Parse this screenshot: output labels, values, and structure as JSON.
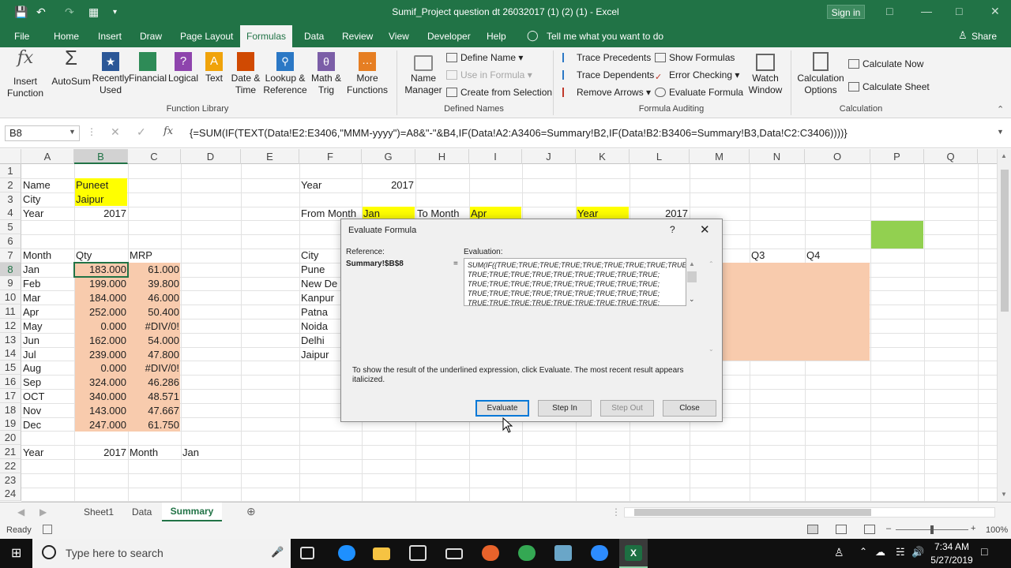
{
  "window": {
    "title": "Sumif_Project question dt 26032017 (1) (2) (1)  -  Excel",
    "signin_label": "Sign in"
  },
  "ribbon_tabs": [
    "File",
    "Home",
    "Insert",
    "Draw",
    "Page Layout",
    "Formulas",
    "Data",
    "Review",
    "View",
    "Developer",
    "Help"
  ],
  "active_tab": "Formulas",
  "tell_me": "Tell me what you want to do",
  "share_label": "Share",
  "ribbon": {
    "function_library": {
      "label": "Function Library",
      "insert_function": "Insert\nFunction",
      "autosum": "AutoSum",
      "recently_used": "Recently\nUsed",
      "financial": "Financial",
      "logical": "Logical",
      "text": "Text",
      "date_time": "Date &\nTime",
      "lookup_reference": "Lookup &\nReference",
      "math_trig": "Math &\nTrig",
      "more_functions": "More\nFunctions"
    },
    "defined_names": {
      "label": "Defined Names",
      "name_manager": "Name\nManager",
      "define_name": "Define Name",
      "use_in_formula": "Use in Formula",
      "create_from_selection": "Create from Selection"
    },
    "formula_auditing": {
      "label": "Formula Auditing",
      "trace_precedents": "Trace Precedents",
      "trace_dependents": "Trace Dependents",
      "remove_arrows": "Remove Arrows",
      "show_formulas": "Show Formulas",
      "error_checking": "Error Checking",
      "evaluate_formula": "Evaluate Formula",
      "watch_window": "Watch\nWindow"
    },
    "calculation": {
      "label": "Calculation",
      "calculation_options": "Calculation\nOptions",
      "calculate_now": "Calculate Now",
      "calculate_sheet": "Calculate Sheet"
    }
  },
  "formula_bar": {
    "name_box": "B8",
    "formula": "{=SUM(IF(TEXT(Data!E2:E3406,\"MMM-yyyy\")=A8&\"-\"&B4,IF(Data!A2:A3406=Summary!B2,IF(Data!B2:B3406=Summary!B3,Data!C2:C3406))))}"
  },
  "columns": [
    "A",
    "B",
    "C",
    "D",
    "E",
    "F",
    "G",
    "H",
    "I",
    "J",
    "K",
    "L",
    "M",
    "N",
    "O",
    "P",
    "Q"
  ],
  "rows": [
    "1",
    "2",
    "3",
    "4",
    "5",
    "6",
    "7",
    "8",
    "9",
    "10",
    "11",
    "12",
    "13",
    "14",
    "15",
    "16",
    "17",
    "18",
    "19",
    "20",
    "21",
    "22",
    "23",
    "24"
  ],
  "cells": {
    "A2": "Name",
    "B2": "Puneet",
    "A3": "City",
    "B3": "Jaipur",
    "A4": "Year",
    "B4": "2017",
    "A7": "Month",
    "B7": "Qty",
    "C7": "MRP",
    "A8": "Jan",
    "B8": "183.000",
    "C8": "61.000",
    "A9": "Feb",
    "B9": "199.000",
    "C9": "39.800",
    "A10": "Mar",
    "B10": "184.000",
    "C10": "46.000",
    "A11": "Apr",
    "B11": "252.000",
    "C11": "50.400",
    "A12": "May",
    "B12": "0.000",
    "C12": "#DIV/0!",
    "A13": "Jun",
    "B13": "162.000",
    "C13": "54.000",
    "A14": "Jul",
    "B14": "239.000",
    "C14": "47.800",
    "A15": "Aug",
    "B15": "0.000",
    "C15": "#DIV/0!",
    "A16": "Sep",
    "B16": "324.000",
    "C16": "46.286",
    "A17": "OCT",
    "B17": "340.000",
    "C17": "48.571",
    "A18": "Nov",
    "B18": "143.000",
    "C18": "47.667",
    "A19": "Dec",
    "B19": "247.000",
    "C19": "61.750",
    "A21": "Year",
    "B21": "2017",
    "C21": "Month",
    "D21": "Jan",
    "F2": "Year",
    "G2": "2017",
    "F4": "From Month",
    "G4": "Jan",
    "H4": "To Month",
    "I4": "Apr",
    "K4": "Year",
    "L4": "2017",
    "F7": "City",
    "N7": "Q3",
    "O7": "Q4",
    "F8": "Pune",
    "F9": "New De",
    "F10": "Kanpur",
    "F11": "Patna",
    "F12": "Noida",
    "F13": "Delhi",
    "F14": "Jaipur"
  },
  "dialog": {
    "title": "Evaluate Formula",
    "help": "?",
    "reference_label": "Reference:",
    "reference_value": "Summary!$B$8",
    "equals": "=",
    "evaluation_label": "Evaluation:",
    "evaluation_lines": [
      "SUM(IF({TRUE;TRUE;TRUE;TRUE;TRUE;TRUE;TRUE;TRUE;TRUE;",
      "TRUE;TRUE;TRUE;TRUE;TRUE;TRUE;TRUE;TRUE;TRUE;",
      "TRUE;TRUE;TRUE;TRUE;TRUE;TRUE;TRUE;TRUE;TRUE;",
      "TRUE;TRUE;TRUE;TRUE;TRUE;TRUE;TRUE;TRUE;TRUE;",
      "TRUE;TRUE;TRUE;TRUE;TRUE;TRUE;TRUE;TRUE;TRUE;"
    ],
    "hint": "To show the result of the underlined expression, click Evaluate.  The most recent result appears italicized.",
    "evaluate": "Evaluate",
    "step_in": "Step In",
    "step_out": "Step Out",
    "close": "Close"
  },
  "sheet_tabs": [
    "Sheet1",
    "Data",
    "Summary"
  ],
  "active_sheet": "Summary",
  "status": {
    "ready": "Ready",
    "zoom": "100%"
  },
  "taskbar": {
    "search_placeholder": "Type here to search",
    "time": "7:34 AM",
    "date": "5/27/2019"
  },
  "colors": {
    "excel_green": "#217346",
    "highlight_yellow": "#ffff00",
    "highlight_peach": "#f8cbad",
    "highlight_green": "#92d050"
  }
}
